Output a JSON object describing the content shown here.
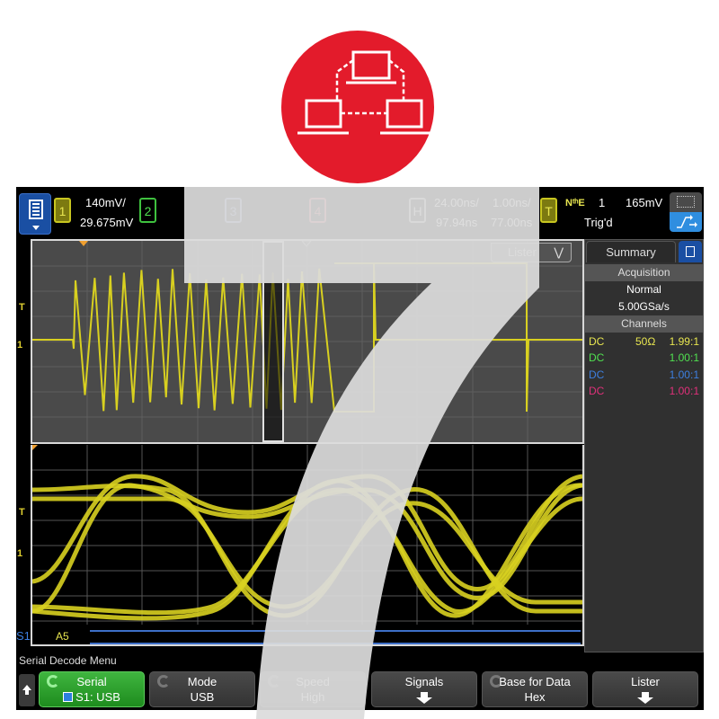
{
  "logo": {
    "icon": "network-computers-icon",
    "color": "#e31b2b"
  },
  "overlay": {
    "glyph": "7"
  },
  "topbar": {
    "menu_icon": "document-menu-icon",
    "channel1": {
      "label": "1",
      "scale": "140mV/",
      "offset": "29.675mV",
      "color": "#c8c620"
    },
    "channel2": {
      "label": "2",
      "color": "#3fc23f"
    },
    "channel3": {
      "label": "3",
      "color": "#7a8fc8"
    },
    "channel4": {
      "label": "4",
      "color": "#d8596a"
    },
    "horizontal": {
      "label": "H",
      "timebase": "24.00ns/",
      "delay": "97.94ns",
      "zoom_timebase": "1.00ns/",
      "zoom_delay": "77.00ns"
    },
    "trigger": {
      "label": "T",
      "type": "NᵗʰE",
      "source": "1",
      "level": "165mV",
      "status": "Trig'd"
    }
  },
  "display": {
    "lister_tab": "Lister",
    "left_markers": {
      "trigger": "T",
      "ch1": "1"
    },
    "serial": {
      "bus_label": "S1",
      "decoded_value": "A5",
      "bus_color": "#3d6fc8"
    },
    "waveform_color": "#d8d020"
  },
  "right_panel": {
    "tab": "Summary",
    "acquisition_header": "Acquisition",
    "acquisition_mode": "Normal",
    "sample_rate": "5.00GSa/s",
    "channels_header": "Channels",
    "channels": [
      {
        "coupling": "DC",
        "impedance": "50Ω",
        "probe": "1.99:1",
        "color": "#e8e650"
      },
      {
        "coupling": "DC",
        "impedance": "",
        "probe": "1.00:1",
        "color": "#50e050"
      },
      {
        "coupling": "DC",
        "impedance": "",
        "probe": "1.00:1",
        "color": "#3d7fe0"
      },
      {
        "coupling": "DC",
        "impedance": "",
        "probe": "1.00:1",
        "color": "#e0307a"
      }
    ]
  },
  "menu": {
    "title": "Serial Decode Menu",
    "softkeys": [
      {
        "top": "Serial",
        "bottom": "S1: USB",
        "active": true
      },
      {
        "top": "Mode",
        "bottom": "USB"
      },
      {
        "top": "Speed",
        "bottom": "High"
      },
      {
        "top": "Signals",
        "bottom": ""
      },
      {
        "top": "Base for Data",
        "bottom": "Hex"
      },
      {
        "top": "Lister",
        "bottom": ""
      }
    ]
  }
}
